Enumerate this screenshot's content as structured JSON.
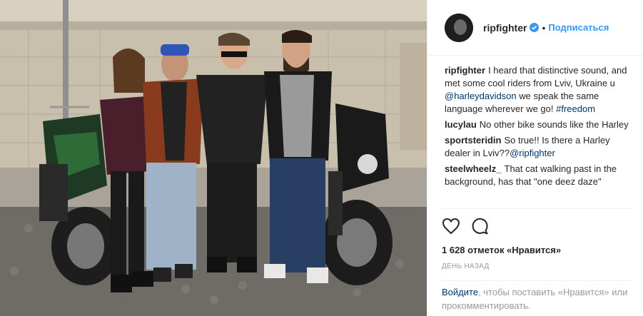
{
  "post": {
    "username": "ripfighter",
    "follow_label": "Подписаться",
    "dot": "•"
  },
  "comments": [
    {
      "user": "ripfighter",
      "parts": [
        "I heard that distinctive sound, and met some cool riders from Lviv, Ukraine u⁣ ",
        "@harleydavidson",
        " we speak the same language wherever we go! ",
        "#freedom"
      ]
    },
    {
      "user": "lucylau",
      "text": "No other bike sounds like the Harley"
    },
    {
      "user": "sportsteridin",
      "text": "So true!! Is there a Harley dealer in Lviv??",
      "mention": "@ripfighter"
    },
    {
      "user": "steelwheelz_",
      "text": "That cat walking past in the background, has that \"one deez daze\""
    }
  ],
  "likes_text": "1 628 отметок «Нравится»",
  "time_text": "ДЕНЬ НАЗАД",
  "login": {
    "link": "Войдите",
    "text": ", чтобы поставить «Нравится» или прокомментировать."
  },
  "icons": {
    "like": "heart-icon",
    "comment": "speech-bubble-icon",
    "verified": "verified-badge-icon"
  },
  "colors": {
    "link_blue": "#3897f0",
    "link_dark": "#003569",
    "muted": "#999999",
    "text": "#262626"
  }
}
